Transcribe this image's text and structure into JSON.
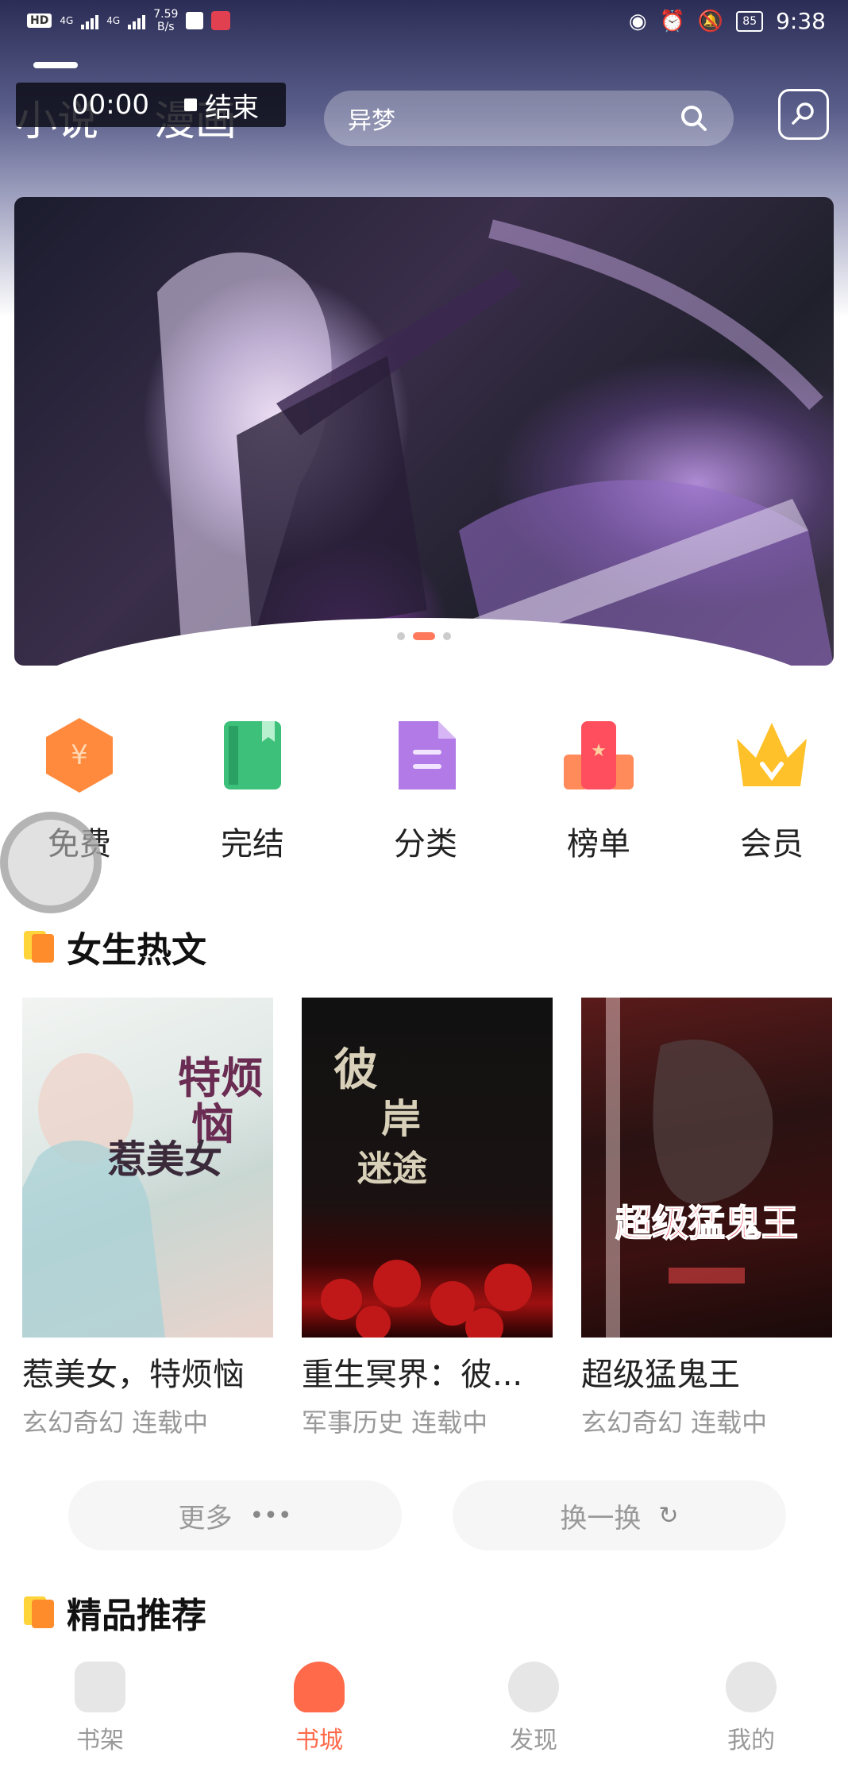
{
  "status_bar": {
    "left_chip": "HD",
    "network_1": "4G",
    "network_2": "4G",
    "speed_value": "7.59",
    "speed_unit": "B/s",
    "battery": "85",
    "time": "9:38"
  },
  "recorder": {
    "time": "00:00",
    "end_label": "结束"
  },
  "header": {
    "tabs": [
      "小说",
      "漫画"
    ],
    "active_tab": "小说",
    "search_placeholder": "异梦"
  },
  "categories": [
    {
      "label": "免费",
      "icon": "free-hexagon-icon",
      "color": "#ff8a3d"
    },
    {
      "label": "完结",
      "icon": "completed-book-icon",
      "color": "#3cc07a"
    },
    {
      "label": "分类",
      "icon": "category-doc-icon",
      "color": "#b27ae6"
    },
    {
      "label": "榜单",
      "icon": "ranking-podium-icon",
      "color": "#ff5a5a"
    },
    {
      "label": "会员",
      "icon": "vip-crown-icon",
      "color": "#ffc12a"
    }
  ],
  "section_female": {
    "title": "女生热文"
  },
  "books": [
    {
      "title": "惹美女，特烦恼",
      "meta": "玄幻奇幻 连载中",
      "cover_text": "惹美女 特烦恼"
    },
    {
      "title": "重生冥界：彼...",
      "meta": "军事历史 连载中",
      "cover_text": "彼岸迷途"
    },
    {
      "title": "超级猛鬼王",
      "meta": "玄幻奇幻 连载中",
      "cover_text": "超级猛鬼王"
    }
  ],
  "actions": {
    "more_label": "更多",
    "refresh_label": "换一换"
  },
  "section_premium": {
    "title": "精品推荐"
  },
  "bottom_nav": [
    {
      "label": "书架",
      "icon": "bookshelf-icon"
    },
    {
      "label": "书城",
      "icon": "bookstore-icon"
    },
    {
      "label": "发现",
      "icon": "discover-icon"
    },
    {
      "label": "我的",
      "icon": "profile-icon"
    }
  ],
  "active_nav": "书城",
  "colors": {
    "accent": "#ff6a4a",
    "header_dark": "#2b2d56"
  }
}
